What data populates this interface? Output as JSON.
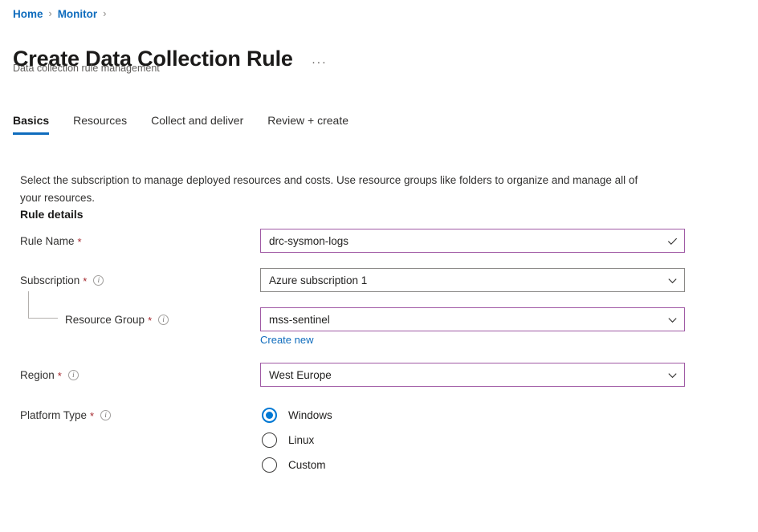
{
  "breadcrumb": {
    "items": [
      {
        "label": "Home"
      },
      {
        "label": "Monitor"
      }
    ],
    "separator": "›"
  },
  "header": {
    "title": "Create Data Collection Rule",
    "subtitle": "Data collection rule management",
    "more_label": "···"
  },
  "tabs": [
    {
      "label": "Basics",
      "active": true
    },
    {
      "label": "Resources",
      "active": false
    },
    {
      "label": "Collect and deliver",
      "active": false
    },
    {
      "label": "Review + create",
      "active": false
    }
  ],
  "main": {
    "description": "Select the subscription to manage deployed resources and costs. Use resource groups like folders to organize and manage all of your resources.",
    "section_heading": "Rule details"
  },
  "fields": {
    "rule_name": {
      "label": "Rule Name",
      "required_mark": "*",
      "value": "drc-sysmon-logs",
      "affix_icon": "checkmark-icon"
    },
    "subscription": {
      "label": "Subscription",
      "required_mark": "*",
      "info_icon": "info-icon",
      "info_glyph": "i",
      "value": "Azure subscription 1",
      "affix_icon": "chevron-down-icon"
    },
    "resource_group": {
      "label": "Resource Group",
      "required_mark": "*",
      "info_icon": "info-icon",
      "info_glyph": "i",
      "value": "mss-sentinel",
      "affix_icon": "chevron-down-icon",
      "create_new_label": "Create new"
    },
    "region": {
      "label": "Region",
      "required_mark": "*",
      "info_icon": "info-icon",
      "info_glyph": "i",
      "value": "West Europe",
      "affix_icon": "chevron-down-icon"
    },
    "platform_type": {
      "label": "Platform Type",
      "required_mark": "*",
      "info_icon": "info-icon",
      "info_glyph": "i",
      "options": [
        {
          "label": "Windows",
          "selected": true
        },
        {
          "label": "Linux",
          "selected": false
        },
        {
          "label": "Custom",
          "selected": false
        }
      ]
    }
  },
  "colors": {
    "link": "#0f6cbd",
    "accent": "#0078d4",
    "modified_border": "#a05aa5",
    "default_border": "#8a8886",
    "required": "#a4262c",
    "background": "#ffffff"
  }
}
